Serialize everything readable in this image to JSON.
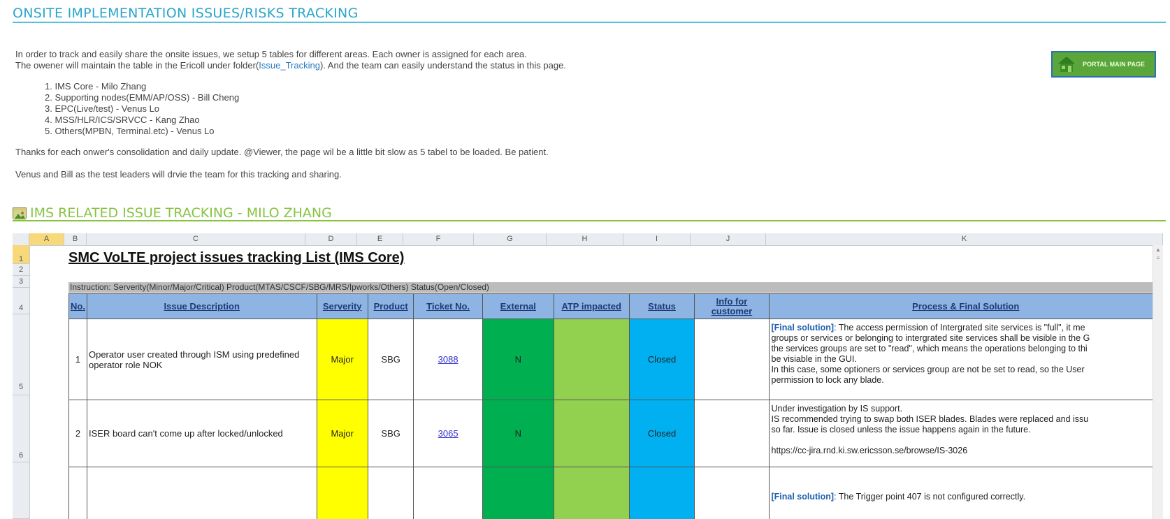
{
  "header": {
    "title": "ONSITE IMPLEMENTATION ISSUES/RISKS TRACKING"
  },
  "intro": {
    "line1": "In order to track and easily share the onsite issues, we setup 5 tables for different areas. Each owner is assigned for each area.",
    "line2_pre": "The owener will maintain the table in the Ericoll under folder(",
    "line2_link": "Issue_Tracking",
    "line2_post": "). And the team can easily understand the status in this page.",
    "areas": [
      "1. IMS Core - Milo Zhang",
      "2. Supporting nodes(EMM/AP/OSS) - Bill Cheng",
      "3. EPC(Live/test) - Venus Lo",
      "4. MSS/HLR/ICS/SRVCC - Kang Zhao",
      "5. Others(MPBN, Terminal.etc) - Venus Lo"
    ],
    "thanks": "Thanks for each onwer's consolidation and daily update. @Viewer, the page wil be a little bit slow as 5 tabel to be loaded. Be patient.",
    "leaders": "Venus and Bill as the test leaders will drvie the team for this tracking and sharing."
  },
  "portal_button": {
    "label": "PORTAL MAIN PAGE",
    "icon": "home-icon"
  },
  "section": {
    "title": "IMS RELATED ISSUE TRACKING - MILO ZHANG",
    "icon": "image-icon"
  },
  "sheet": {
    "columns": [
      "A",
      "B",
      "C",
      "D",
      "E",
      "F",
      "G",
      "H",
      "I",
      "J",
      "K"
    ],
    "rows": [
      "1",
      "2",
      "3",
      "4",
      "5",
      "6"
    ],
    "title": "SMC VoLTE project issues tracking List (IMS Core)",
    "instruction": "Instruction: Serverity(Minor/Major/Critical) Product(MTAS/CSCF/SBG/MRS/Ipworks/Others) Status(Open/Closed)",
    "headers": {
      "no": "No.",
      "desc": "Issue Description",
      "severity": "Serverity",
      "product": "Product",
      "ticket": "Ticket No.",
      "external": "External",
      "atp": "ATP impacted",
      "status": "Status",
      "info": "Info for customer",
      "solution": "Process & Final Solution"
    },
    "issues": [
      {
        "no": "1",
        "desc": "Operator user created through ISM using predefined operator role NOK",
        "severity": "Major",
        "product": "SBG",
        "ticket": "3088",
        "external": "N",
        "atp": "",
        "status": "Closed",
        "info": "",
        "sol_tag": "[Final solution]",
        "sol_1": ": The access permission of Intergrated site services is \"full\", it me",
        "sol_2": "groups or services or belonging to intergrated site services shall be visible in the G",
        "sol_3": "the services groups are set to \"read\", which means the operations belonging to thi",
        "sol_4": "be visiable in the GUI.",
        "sol_5": "In this case, some optioners or services group are not be set to read, so the User",
        "sol_6": "permission to lock any blade."
      },
      {
        "no": "2",
        "desc": "ISER board can't come up after locked/unlocked",
        "severity": "Major",
        "product": "SBG",
        "ticket": "3065",
        "external": "N",
        "atp": "",
        "status": "Closed",
        "info": "",
        "sol_1": "Under investigation by IS support.",
        "sol_2": "IS recommended trying to swap both ISER blades. Blades were replaced and issu",
        "sol_3": "so far. Issue is closed unless the issue happens again in the future.",
        "sol_4": "https://cc-jira.rnd.ki.sw.ericsson.se/browse/IS-3026"
      },
      {
        "sol_tag": "[Final solution]",
        "sol_1": ": The Trigger point 407 is not configured correctly."
      }
    ]
  }
}
